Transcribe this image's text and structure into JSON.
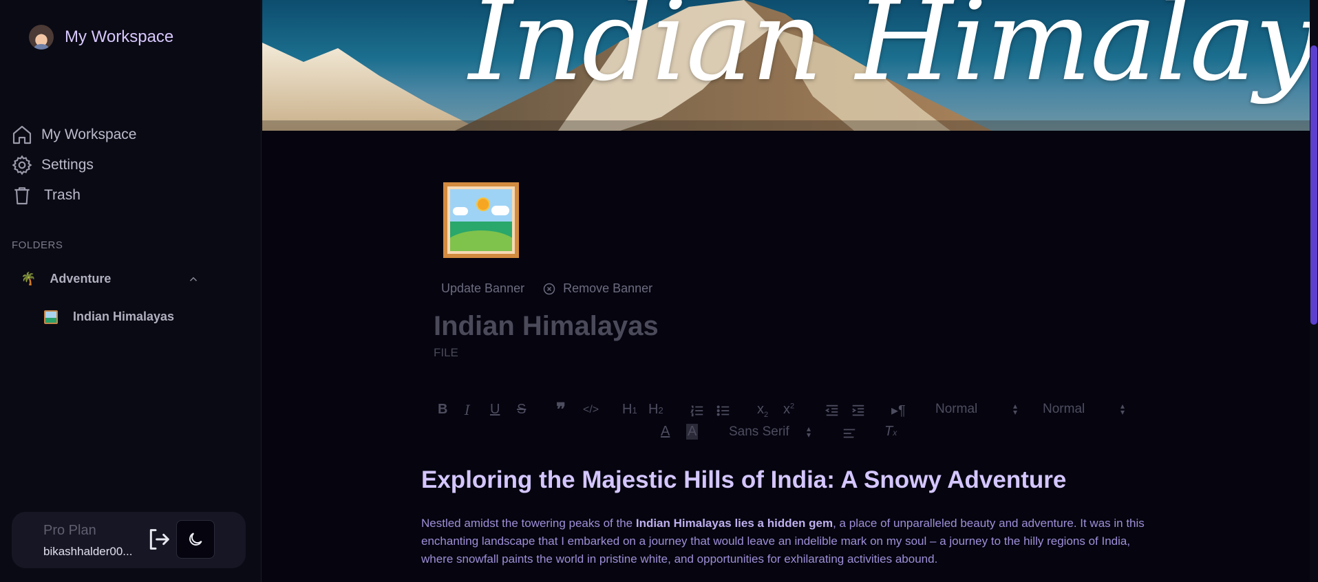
{
  "workspace": {
    "name": "My Workspace"
  },
  "nav": {
    "items": [
      {
        "label": "My Workspace",
        "icon": "home-icon"
      },
      {
        "label": "Settings",
        "icon": "gear-icon"
      },
      {
        "label": "Trash",
        "icon": "trash-icon"
      }
    ]
  },
  "folders": {
    "heading": "FOLDERS",
    "items": [
      {
        "emoji": "🌴",
        "label": "Adventure",
        "files": [
          {
            "label": "Indian Himalayas"
          }
        ]
      }
    ]
  },
  "plan": {
    "label": "Pro Plan",
    "email": "bikashhalder00..."
  },
  "banner": {
    "title": "Indian Himalayas"
  },
  "document": {
    "update_banner": "Update Banner",
    "remove_banner": "Remove Banner",
    "title": "Indian Himalayas",
    "type": "FILE"
  },
  "toolbar": {
    "header_select": "Normal",
    "size_select": "Normal",
    "font_select": "Sans Serif"
  },
  "content": {
    "heading": "Exploring the Majestic Hills of India: A Snowy Adventure",
    "para_part1": "Nestled amidst the towering peaks of the ",
    "para_bold": "Indian Himalayas lies a hidden gem",
    "para_part2": ", a place of unparalleled beauty and adventure. It was in this enchanting landscape that I embarked on a journey that would leave an indelible mark on my soul – a journey to the hilly regions of India, where snowfall paints the world in pristine white, and opportunities for exhilarating activities abound."
  },
  "colors": {
    "accent": "#d8c8ff",
    "scroll_thumb": "#5b3fcf",
    "background": "#05040f"
  }
}
